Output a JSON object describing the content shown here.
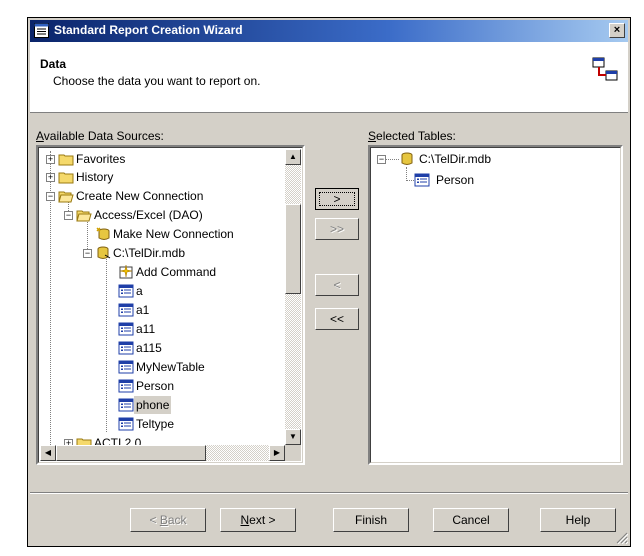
{
  "window": {
    "title": "Standard Report Creation Wizard",
    "close_glyph": "×"
  },
  "header": {
    "title": "Data",
    "subtitle": "Choose the data you want to report on."
  },
  "available": {
    "label_accel": "A",
    "label_rest": "vailable Data Sources:",
    "items": [
      {
        "label": "Favorites",
        "icon": "folder-icon"
      },
      {
        "label": "History",
        "icon": "folder-icon"
      },
      {
        "label": "Create New Connection",
        "icon": "folder-open-icon"
      },
      {
        "label": "Access/Excel (DAO)",
        "icon": "folder-open-icon"
      },
      {
        "label": "Make New Connection",
        "icon": "make-connection-icon"
      },
      {
        "label": "C:\\TelDir.mdb",
        "icon": "database-icon"
      },
      {
        "label": "Add Command",
        "icon": "add-command-icon"
      },
      {
        "label": "a",
        "icon": "table-icon"
      },
      {
        "label": "a1",
        "icon": "table-icon"
      },
      {
        "label": "a11",
        "icon": "table-icon"
      },
      {
        "label": "a115",
        "icon": "table-icon"
      },
      {
        "label": "MyNewTable",
        "icon": "table-icon"
      },
      {
        "label": "Person",
        "icon": "table-icon"
      },
      {
        "label": "phone",
        "icon": "table-icon",
        "selected": true
      },
      {
        "label": "Teltype",
        "icon": "table-icon"
      },
      {
        "label": "ACTI 2.0",
        "icon": "folder-icon"
      }
    ]
  },
  "selected": {
    "label_accel": "S",
    "label_rest": "elected Tables:",
    "items": [
      {
        "label": "C:\\TelDir.mdb",
        "icon": "database-icon"
      },
      {
        "label": "Person",
        "icon": "table-icon"
      }
    ]
  },
  "transfer_buttons": {
    "add": ">",
    "add_all": ">>",
    "remove": "<",
    "remove_all": "<<"
  },
  "footer": {
    "back": {
      "accel": "B",
      "rest": "ack",
      "prefix": "< "
    },
    "next": {
      "accel": "N",
      "rest": "ext >"
    },
    "finish": "Finish",
    "cancel": "Cancel",
    "help": "Help"
  },
  "colors": {
    "title_start": "#0a246a",
    "title_end": "#a6caf0",
    "face": "#d4d0c8"
  }
}
